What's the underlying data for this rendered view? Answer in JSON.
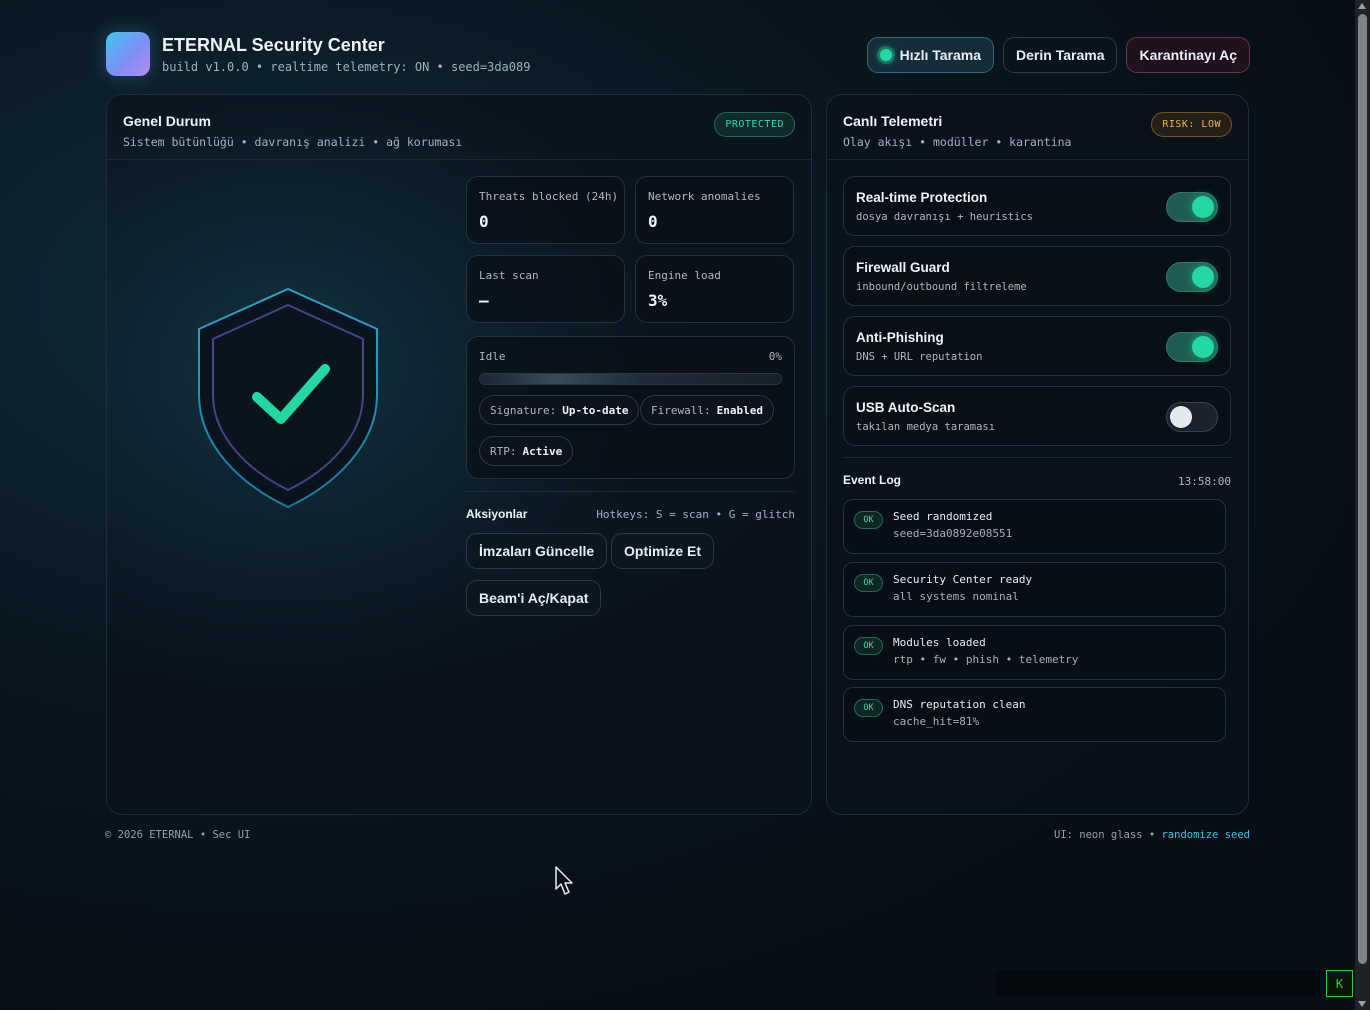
{
  "header": {
    "title": "ETERNAL Security Center",
    "subtitle": "build v1.0.0 • realtime telemetry: ON • seed=3da089",
    "buttons": {
      "quick_scan": "Hızlı Tarama",
      "deep_scan": "Derin Tarama",
      "open_quarantine": "Karantinayı Aç"
    }
  },
  "status_panel": {
    "title": "Genel Durum",
    "subtitle": "Sistem bütünlüğü • davranış analizi • ağ koruması",
    "badge": "PROTECTED",
    "stats": [
      {
        "label": "Threats blocked (24h)",
        "value": "0"
      },
      {
        "label": "Network anomalies",
        "value": "0"
      },
      {
        "label": "Last scan",
        "value": "—"
      },
      {
        "label": "Engine load",
        "value": "3%"
      }
    ],
    "scan": {
      "state": "Idle",
      "percent_label": "0%",
      "progress": 0
    },
    "chips": [
      {
        "key": "Signature:",
        "value": "Up-to-date"
      },
      {
        "key": "Firewall:",
        "value": "Enabled"
      },
      {
        "key": "RTP:",
        "value": "Active"
      }
    ],
    "actions": {
      "title": "Aksiyonlar",
      "hotkeys": "Hotkeys: S = scan • G = glitch",
      "update_signatures": "İmzaları Güncelle",
      "optimize": "Optimize Et",
      "toggle_beam": "Beam'i Aç/Kapat"
    }
  },
  "telemetry_panel": {
    "title": "Canlı Telemetri",
    "subtitle": "Olay akışı • modüller • karantina",
    "badge": "RISK: LOW",
    "modules": [
      {
        "title": "Real-time Protection",
        "subtitle": "dosya davranışı + heuristics",
        "enabled": true
      },
      {
        "title": "Firewall Guard",
        "subtitle": "inbound/outbound filtreleme",
        "enabled": true
      },
      {
        "title": "Anti-Phishing",
        "subtitle": "DNS + URL reputation",
        "enabled": true
      },
      {
        "title": "USB Auto-Scan",
        "subtitle": "takılan medya taraması",
        "enabled": false
      }
    ],
    "event_log": {
      "title": "Event Log",
      "time": "13:58:00",
      "items": [
        {
          "status": "OK",
          "message": "Seed randomized",
          "detail": "seed=3da0892e08551"
        },
        {
          "status": "OK",
          "message": "Security Center ready",
          "detail": "all systems nominal"
        },
        {
          "status": "OK",
          "message": "Modules loaded",
          "detail": "rtp • fw • phish • telemetry"
        },
        {
          "status": "OK",
          "message": "DNS reputation clean",
          "detail": "cache_hit=81%"
        }
      ]
    }
  },
  "footer": {
    "left": "© 2026 ETERNAL • Sec UI",
    "right_prefix": "UI: neon glass •",
    "right_link": "randomize seed"
  },
  "console": {
    "button": "K"
  },
  "colors": {
    "accent": "#25d7a2",
    "link": "#3ec2e6",
    "warning": "#e9b458",
    "background": "#0a1620"
  }
}
